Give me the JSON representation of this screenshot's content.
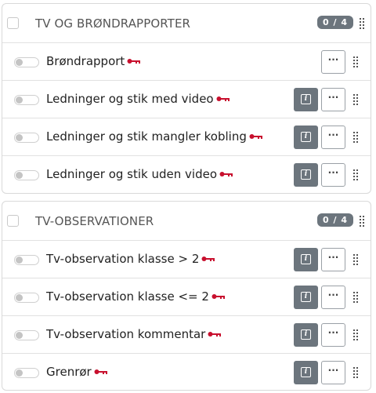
{
  "sections": [
    {
      "title": "TV OG BRØNDRAPPORTER",
      "count": "0 / 4",
      "items": [
        {
          "label": "Brøndrapport",
          "has_info": false
        },
        {
          "label": "Ledninger og stik med video",
          "has_info": true
        },
        {
          "label": "Ledninger og stik mangler kobling",
          "has_info": true
        },
        {
          "label": "Ledninger og stik uden video",
          "has_info": true
        }
      ]
    },
    {
      "title": "TV-OBSERVATIONER",
      "count": "0 / 4",
      "items": [
        {
          "label": "Tv-observation klasse > 2",
          "has_info": true
        },
        {
          "label": "Tv-observation klasse <= 2",
          "has_info": true
        },
        {
          "label": "Tv-observation kommentar",
          "has_info": true
        },
        {
          "label": "Grenrør",
          "has_info": true
        }
      ]
    }
  ],
  "icons": {
    "key": "key-icon",
    "info": "info-icon",
    "more": "ellipsis-icon",
    "drag": "drag-handle-icon"
  },
  "colors": {
    "key": "#c8102e",
    "info_button": "#6c757d",
    "badge": "#6c757d"
  },
  "more_label": "···"
}
